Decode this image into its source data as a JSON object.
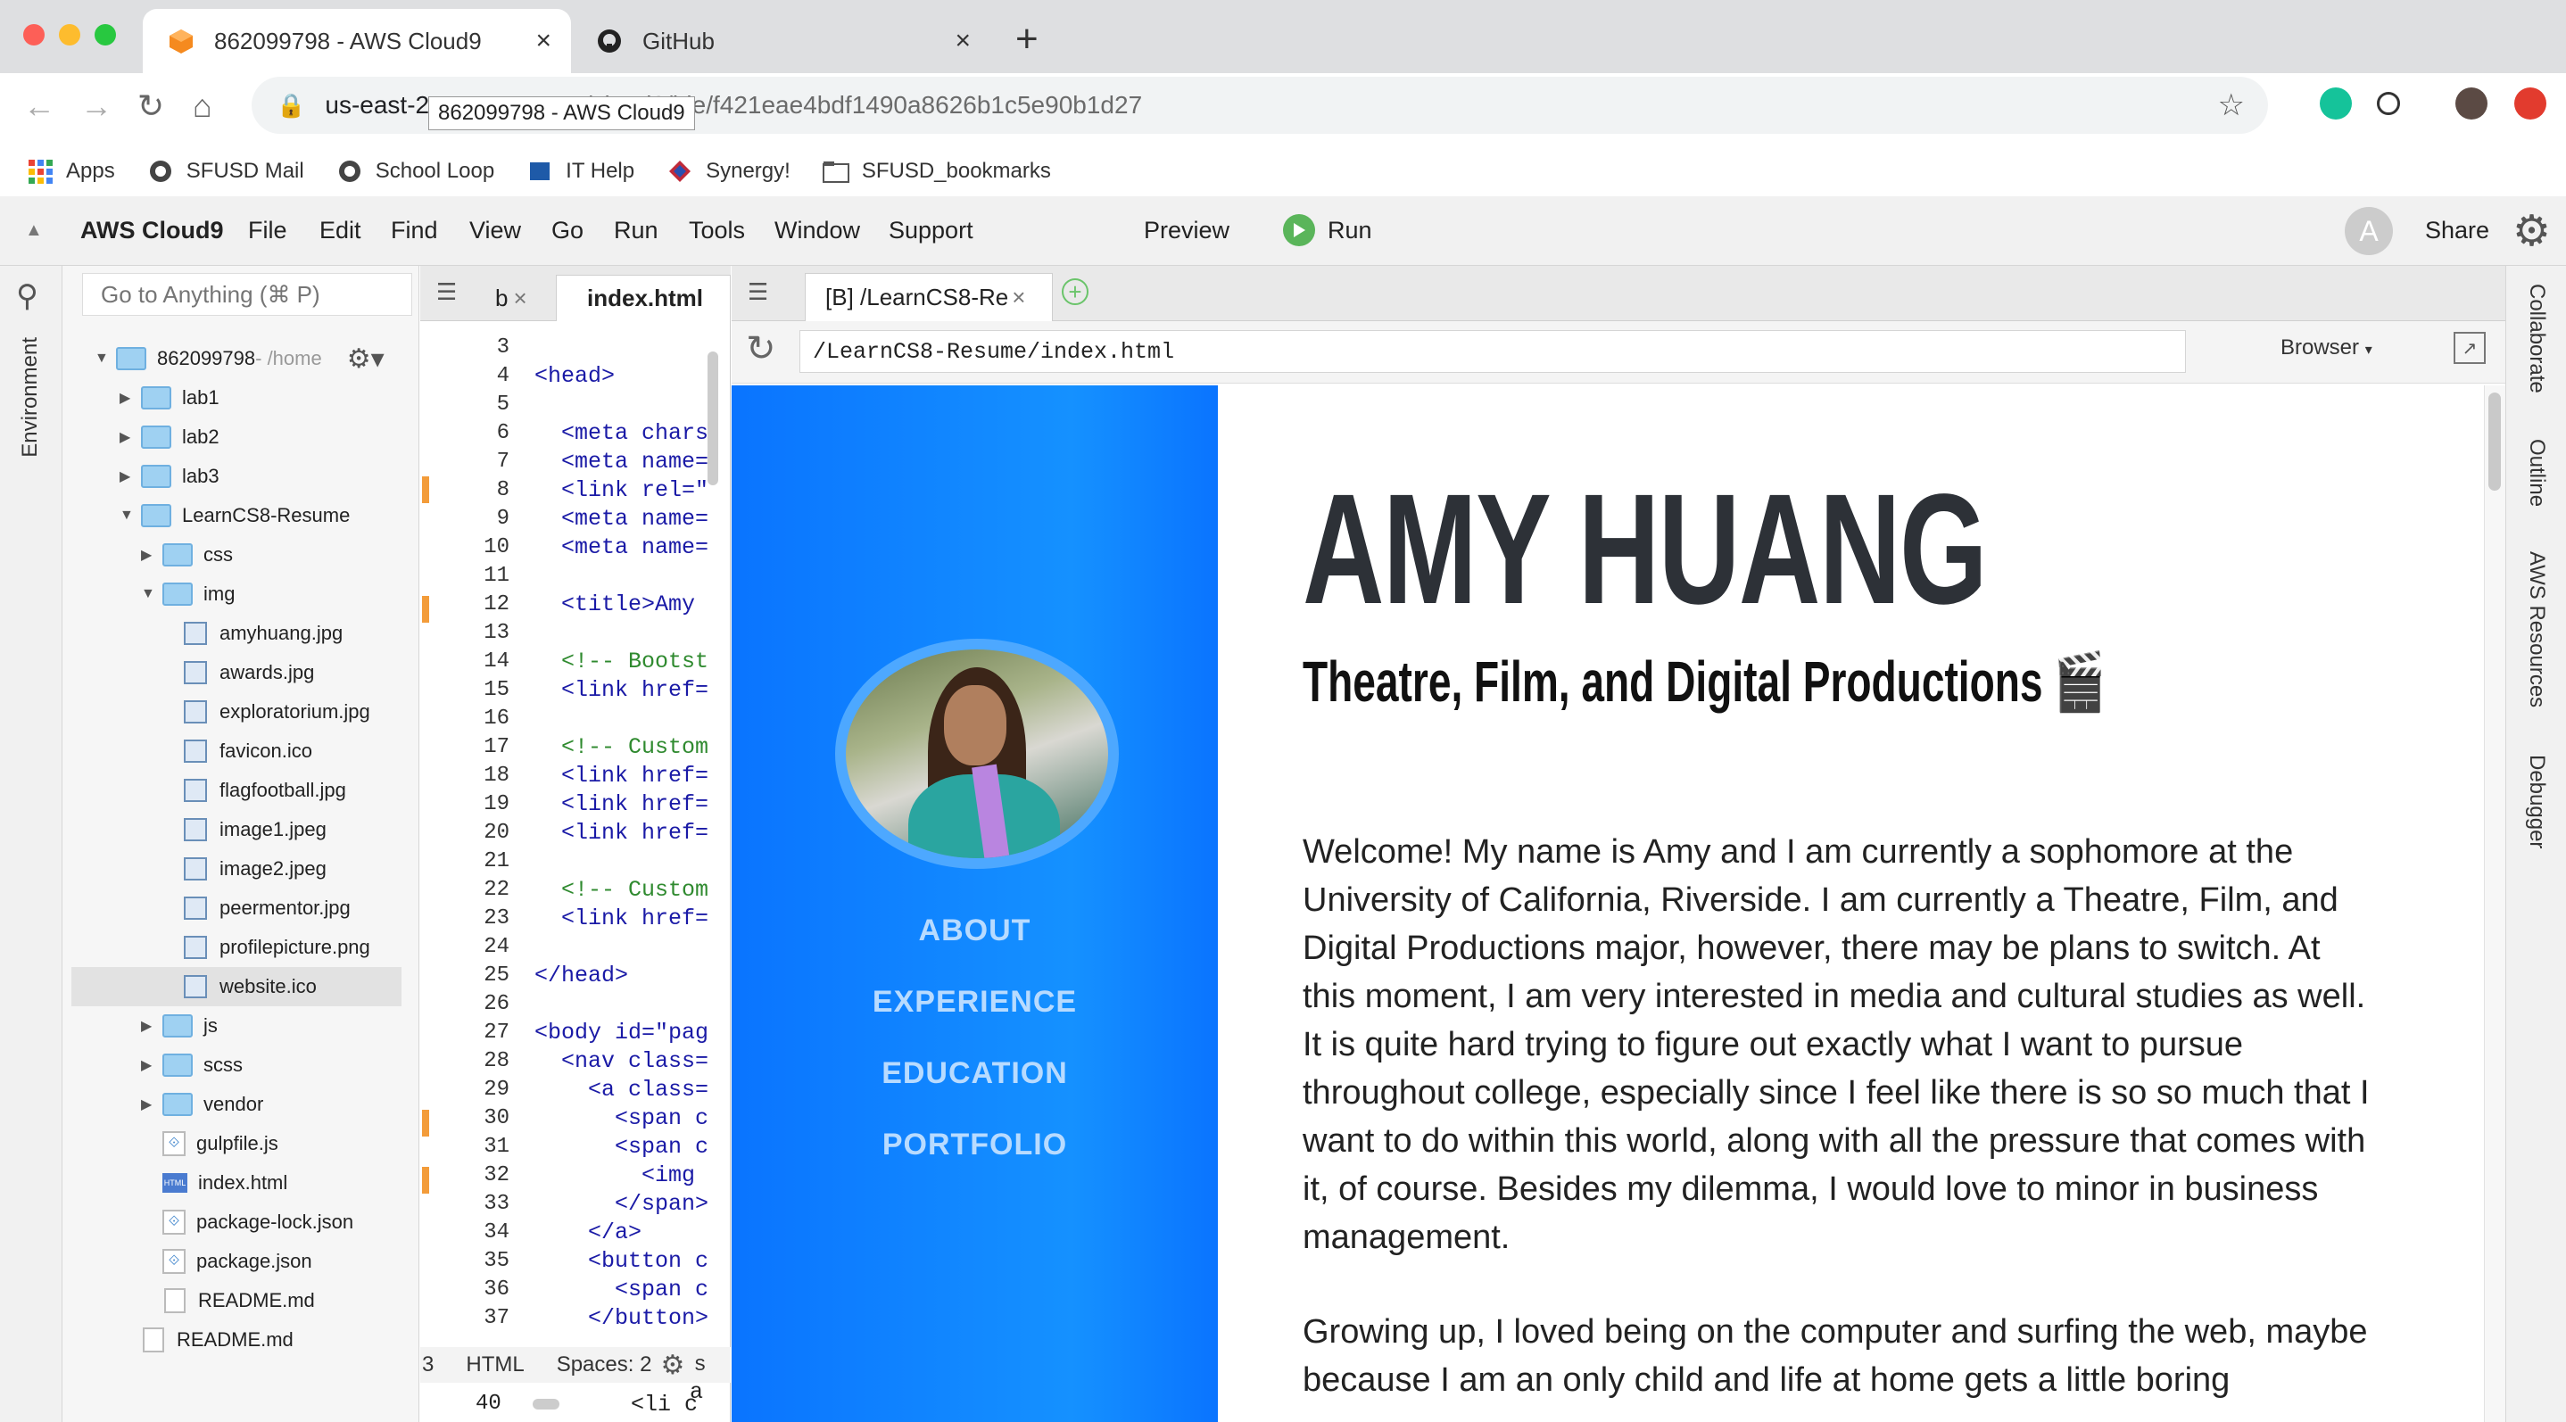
{
  "browser": {
    "tabs": [
      {
        "title": "862099798 - AWS Cloud9",
        "icon": "aws-cube-icon"
      },
      {
        "title": "GitHub",
        "icon": "github-icon"
      }
    ],
    "url_host": "us-east-2.",
    "url_path": "om/cloud9/ide/f421eae4bdf1490a8626b1c5e90b1d27",
    "tooltip": "862099798 - AWS Cloud9",
    "bookmarks": [
      "Apps",
      "SFUSD Mail",
      "School Loop",
      "IT Help",
      "Synergy!",
      "SFUSD_bookmarks"
    ]
  },
  "c9": {
    "brand": "AWS Cloud9",
    "menu": [
      "File",
      "Edit",
      "Find",
      "View",
      "Go",
      "Run",
      "Tools",
      "Window",
      "Support"
    ],
    "preview": "Preview",
    "run": "Run",
    "avatar_letter": "A",
    "share": "Share",
    "left_panel_label": "Environment",
    "right_panel_labels": [
      "Collaborate",
      "Outline",
      "AWS Resources",
      "Debugger"
    ],
    "search_placeholder": "Go to Anything (⌘ P)"
  },
  "tree": {
    "root": "862099798",
    "root_suffix": " - /home",
    "items": [
      {
        "label": "lab1",
        "type": "folder",
        "depth": 1,
        "open": false
      },
      {
        "label": "lab2",
        "type": "folder",
        "depth": 1,
        "open": false
      },
      {
        "label": "lab3",
        "type": "folder",
        "depth": 1,
        "open": false
      },
      {
        "label": "LearnCS8-Resume",
        "type": "folder",
        "depth": 1,
        "open": true
      },
      {
        "label": "css",
        "type": "folder",
        "depth": 2,
        "open": false
      },
      {
        "label": "img",
        "type": "folder",
        "depth": 2,
        "open": true
      },
      {
        "label": "amyhuang.jpg",
        "type": "image",
        "depth": 3
      },
      {
        "label": "awards.jpg",
        "type": "image",
        "depth": 3
      },
      {
        "label": "exploratorium.jpg",
        "type": "image",
        "depth": 3
      },
      {
        "label": "favicon.ico",
        "type": "image",
        "depth": 3
      },
      {
        "label": "flagfootball.jpg",
        "type": "image",
        "depth": 3
      },
      {
        "label": "image1.jpeg",
        "type": "image",
        "depth": 3
      },
      {
        "label": "image2.jpeg",
        "type": "image",
        "depth": 3
      },
      {
        "label": "peermentor.jpg",
        "type": "image",
        "depth": 3
      },
      {
        "label": "profilepicture.png",
        "type": "image",
        "depth": 3
      },
      {
        "label": "website.ico",
        "type": "image",
        "depth": 3,
        "selected": true
      },
      {
        "label": "js",
        "type": "folder",
        "depth": 2,
        "open": false
      },
      {
        "label": "scss",
        "type": "folder",
        "depth": 2,
        "open": false
      },
      {
        "label": "vendor",
        "type": "folder",
        "depth": 2,
        "open": false
      },
      {
        "label": "gulpfile.js",
        "type": "js",
        "depth": 2
      },
      {
        "label": "index.html",
        "type": "html",
        "depth": 2
      },
      {
        "label": "package-lock.json",
        "type": "js",
        "depth": 2
      },
      {
        "label": "package.json",
        "type": "js",
        "depth": 2
      },
      {
        "label": "README.md",
        "type": "md",
        "depth": 2
      },
      {
        "label": "README.md",
        "type": "md",
        "depth": 1
      }
    ]
  },
  "editor": {
    "tabs": [
      "b",
      "index.html"
    ],
    "line_numbers": [
      "3",
      "4",
      "5",
      "6",
      "7",
      "8",
      "9",
      "10",
      "11",
      "12",
      "13",
      "14",
      "15",
      "16",
      "17",
      "18",
      "19",
      "20",
      "21",
      "22",
      "23",
      "24",
      "25",
      "26",
      "27",
      "28",
      "29",
      "30",
      "31",
      "32",
      "33",
      "34",
      "35",
      "36",
      "37"
    ],
    "lines": [
      "",
      "<head>",
      "",
      "  <meta chars",
      "  <meta name=",
      "  <link rel=\"",
      "  <meta name=",
      "  <meta name=",
      "",
      "  <title>Amy",
      "",
      "  <!-- Bootst",
      "  <link href=",
      "",
      "  <!-- Custom",
      "  <link href=",
      "  <link href=",
      "  <link href=",
      "",
      "  <!-- Custom",
      "  <link href=",
      "",
      "</head>",
      "",
      "<body id=\"pag",
      "  <nav class=",
      "    <a class=",
      "      <span c",
      "      <span c",
      "        <img",
      "      </span>",
      "    </a>",
      "    <button c",
      "      <span c",
      "    </button>"
    ],
    "status_line": "3",
    "status_mode": "HTML",
    "status_spaces": "Spaces: 2",
    "bottom_line_number": "40",
    "bottom_code": "    <li c",
    "partial_line_1": "s",
    "partial_line_2": "a"
  },
  "preview_panel": {
    "tab": "[B] /LearnCS8-Re",
    "url": "/LearnCS8-Resume/index.html",
    "browser_button": "Browser",
    "nav": [
      "ABOUT",
      "EXPERIENCE",
      "EDUCATION",
      "PORTFOLIO"
    ],
    "name": "AMY HUANG",
    "subtitle": "Theatre, Film, and Digital Productions 🎬",
    "paragraph1": "Welcome! My name is Amy and I am currently a sophomore at the University of California, Riverside. I am currently a Theatre, Film, and Digital Productions major, however, there may be plans to switch. At this moment, I am very interested in media and cultural studies as well. It is quite hard trying to figure out exactly what I want to pursue throughout college, especially since I feel like there is so so much that I want to do within this world, along with all the pressure that comes with it, of course. Besides my dilemma, I would love to minor in business management.",
    "paragraph2": "Growing up, I loved being on the computer and surfing the web, maybe because I am an only child and life at home gets a little boring"
  },
  "colors": {
    "sidebar_blue": "#0a74ff",
    "nav_text": "#b8dbff",
    "accent_green": "#5ab55a",
    "modified_marker": "#f39c3a"
  }
}
